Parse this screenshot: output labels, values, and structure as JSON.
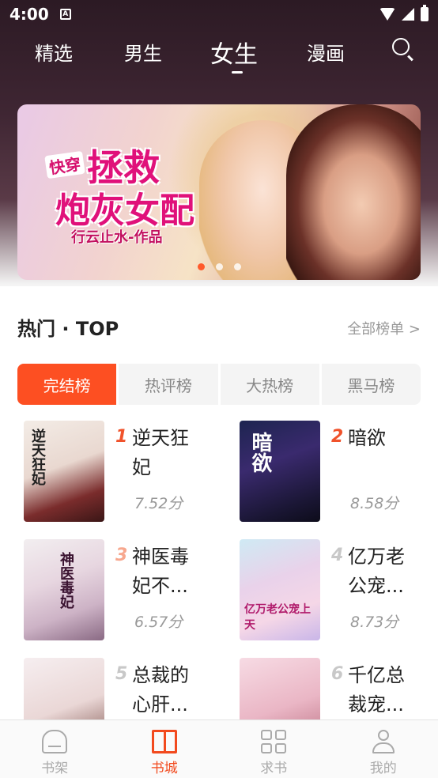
{
  "status_bar": {
    "time": "4:00",
    "notification_icon": "A"
  },
  "top_tabs": [
    {
      "label": "精选",
      "active": false
    },
    {
      "label": "男生",
      "active": false
    },
    {
      "label": "女生",
      "active": true
    },
    {
      "label": "漫画",
      "active": false
    }
  ],
  "banner": {
    "tag": "快穿",
    "title_line1": "拯救",
    "title_line2": "炮灰女配",
    "author": "行云止水-作品",
    "dots": 3,
    "active_dot": 1
  },
  "hot_section": {
    "title": "热门 · TOP",
    "more_link": "全部榜单 >"
  },
  "rank_tabs": [
    {
      "label": "完结榜",
      "active": true
    },
    {
      "label": "热评榜",
      "active": false
    },
    {
      "label": "大热榜",
      "active": false
    },
    {
      "label": "黑马榜",
      "active": false
    }
  ],
  "books": [
    {
      "rank": "1",
      "title": "逆天狂妃",
      "title_display": "逆天狂\n妃",
      "score": "7.52分",
      "cover_text": "逆天狂妃"
    },
    {
      "rank": "2",
      "title": "暗欲",
      "title_display": "暗欲",
      "score": "8.58分",
      "cover_text": "暗欲"
    },
    {
      "rank": "3",
      "title": "神医毒妃不...",
      "title_display": "神医毒\n妃不...",
      "score": "6.57分",
      "cover_text": "神医毒妃"
    },
    {
      "rank": "4",
      "title": "亿万老公宠...",
      "title_display": "亿万老\n公宠...",
      "score": "8.73分",
      "cover_text": "亿万老公宠上天"
    },
    {
      "rank": "5",
      "title": "总裁的心肝...",
      "title_display": "总裁的\n心肝...",
      "score": "",
      "cover_text": ""
    },
    {
      "rank": "6",
      "title": "千亿总裁宠...",
      "title_display": "千亿总\n裁宠...",
      "score": "",
      "cover_text": ""
    }
  ],
  "bottom_nav": [
    {
      "label": "书架",
      "icon": "bookshelf-icon",
      "active": false
    },
    {
      "label": "书城",
      "icon": "open-book-icon",
      "active": true
    },
    {
      "label": "求书",
      "icon": "grid-icon",
      "active": false
    },
    {
      "label": "我的",
      "icon": "user-icon",
      "active": false
    }
  ],
  "colors": {
    "accent": "#fd4f22",
    "rank_top": "#f0522b",
    "rank_other": "#c8c8c8"
  }
}
